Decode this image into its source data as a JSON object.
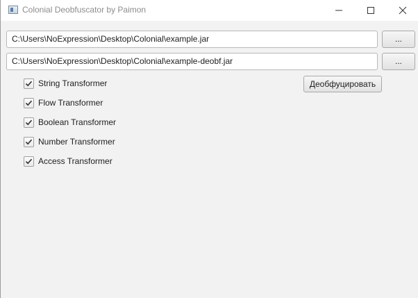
{
  "window": {
    "title": "Colonial Deobfuscator by Paimon"
  },
  "paths": {
    "input_value": "C:\\Users\\NoExpression\\Desktop\\Colonial\\example.jar",
    "output_value": "C:\\Users\\NoExpression\\Desktop\\Colonial\\example-deobf.jar",
    "browse_label": "..."
  },
  "actions": {
    "deobfuscate_label": "Деобфуцировать"
  },
  "transformers": [
    {
      "label": "String Transformer",
      "checked": true
    },
    {
      "label": "Flow Transformer",
      "checked": true
    },
    {
      "label": "Boolean Transformer",
      "checked": true
    },
    {
      "label": "Number Transformer",
      "checked": true
    },
    {
      "label": "Access Transformer",
      "checked": true
    }
  ],
  "icons": {
    "app": "app-window-icon",
    "minimize": "minimize-icon",
    "maximize": "maximize-icon",
    "close": "close-icon",
    "check": "checkmark-icon"
  }
}
